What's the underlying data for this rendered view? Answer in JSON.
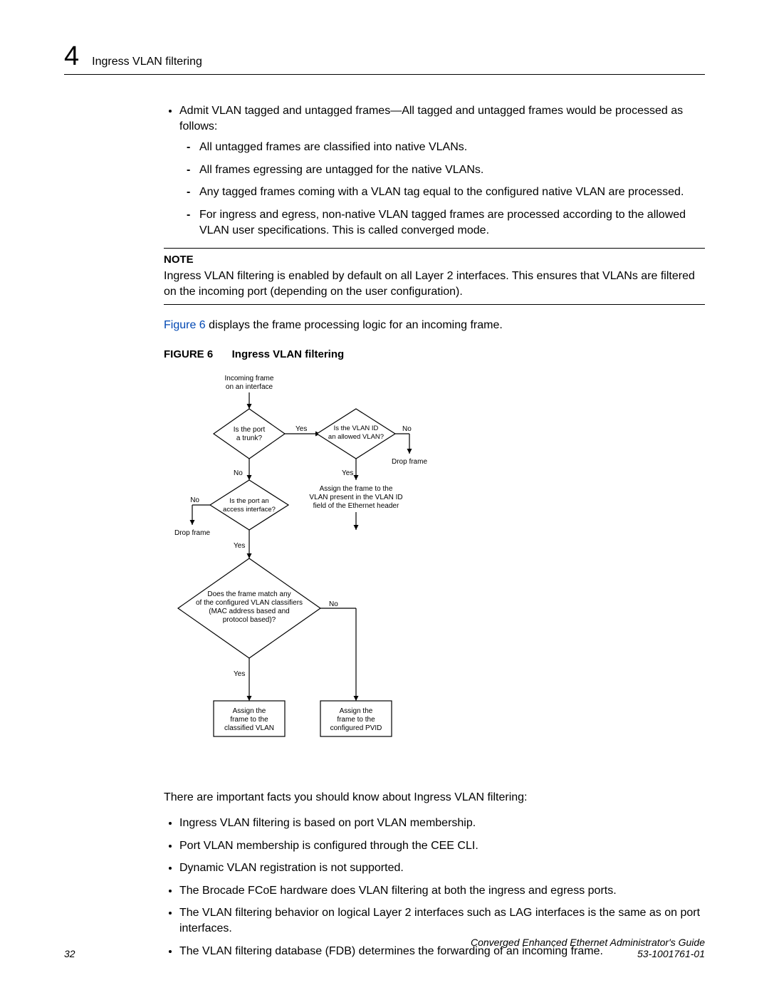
{
  "chapter_number": "4",
  "section_title": "Ingress VLAN filtering",
  "bullet1_intro": "Admit VLAN tagged and untagged frames—All tagged and untagged frames would be processed as follows:",
  "dash_items": [
    "All untagged frames are classified into native VLANs.",
    "All frames egressing are untagged for the native VLANs.",
    "Any tagged frames coming with a VLAN tag equal to the configured native VLAN are processed.",
    "For ingress and egress, non-native VLAN tagged frames are processed according to the allowed VLAN user specifications. This is called converged mode."
  ],
  "note_heading": "NOTE",
  "note_body": "Ingress VLAN filtering is enabled by default on all Layer 2 interfaces. This ensures that VLANs are filtered on the incoming port (depending on the user configuration).",
  "figref": "Figure 6",
  "figref_rest": " displays the frame processing logic for an incoming frame.",
  "figure_label": "FIGURE 6",
  "figure_title": "Ingress VLAN filtering",
  "chart_data": {
    "type": "flowchart",
    "nodes": [
      {
        "id": "start",
        "kind": "text",
        "label": "Incoming frame on an interface"
      },
      {
        "id": "d1",
        "kind": "decision",
        "label": "Is the port a trunk?"
      },
      {
        "id": "d2",
        "kind": "decision",
        "label": "Is the VLAN ID an allowed VLAN?"
      },
      {
        "id": "drop2",
        "kind": "text",
        "label": "Drop frame"
      },
      {
        "id": "assign_vlanid",
        "kind": "text",
        "label": "Assign the frame to the VLAN present in the VLAN ID field of the Ethernet header"
      },
      {
        "id": "d3",
        "kind": "decision",
        "label": "Is the port an access interface?"
      },
      {
        "id": "drop3",
        "kind": "text",
        "label": "Drop frame"
      },
      {
        "id": "d4",
        "kind": "decision",
        "label": "Does the frame match any of the configured VLAN classifiers (MAC address based and protocol based)?"
      },
      {
        "id": "box_classified",
        "kind": "process",
        "label": "Assign the frame to the classified VLAN"
      },
      {
        "id": "box_pvid",
        "kind": "process",
        "label": "Assign the frame to the configured PVID"
      }
    ],
    "edges": [
      {
        "from": "start",
        "to": "d1"
      },
      {
        "from": "d1",
        "to": "d2",
        "label": "Yes"
      },
      {
        "from": "d1",
        "to": "d3",
        "label": "No"
      },
      {
        "from": "d2",
        "to": "drop2",
        "label": "No"
      },
      {
        "from": "d2",
        "to": "assign_vlanid",
        "label": "Yes"
      },
      {
        "from": "d3",
        "to": "drop3",
        "label": "No"
      },
      {
        "from": "d3",
        "to": "d4",
        "label": "Yes"
      },
      {
        "from": "d4",
        "to": "box_classified",
        "label": "Yes"
      },
      {
        "from": "d4",
        "to": "box_pvid",
        "label": "No"
      },
      {
        "from": "assign_vlanid",
        "to": "box_pvid"
      }
    ]
  },
  "facts_intro": "There are important facts you should know about Ingress VLAN filtering:",
  "facts": [
    "Ingress VLAN filtering is based on port VLAN membership.",
    "Port VLAN membership is configured through the CEE CLI.",
    "Dynamic VLAN registration is not supported.",
    "The Brocade FCoE hardware does VLAN filtering at both the ingress and egress ports.",
    "The VLAN filtering behavior on logical Layer 2 interfaces such as LAG interfaces is the same as on port interfaces.",
    "The VLAN filtering database (FDB) determines the forwarding of an incoming frame."
  ],
  "page_number": "32",
  "doc_title": "Converged Enhanced Ethernet Administrator's Guide",
  "doc_id": "53-1001761-01"
}
